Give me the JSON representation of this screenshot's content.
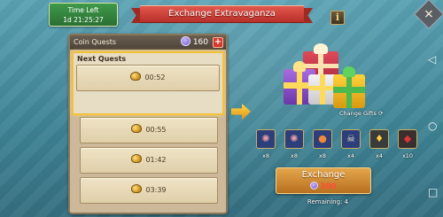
{
  "timer": {
    "label": "Time Left",
    "value": "1d 21:25:27"
  },
  "title": "Exchange Extravaganza",
  "info_icon": "info-icon",
  "panel": {
    "header": "Coin Quests",
    "coins": "160",
    "plus": "+",
    "next_label": "Next Quests",
    "next_quest_time": "00:52",
    "quests": [
      "00:55",
      "01:42",
      "03:39"
    ]
  },
  "change_gifts": "Change Gifts",
  "rewards": [
    {
      "icon": "brain-icon",
      "qty": "x8"
    },
    {
      "icon": "brain-icon",
      "qty": "x8"
    },
    {
      "icon": "orb-icon",
      "qty": "x8"
    },
    {
      "icon": "monster-skull-icon",
      "qty": "x4"
    },
    {
      "icon": "gold-pouch-icon",
      "qty": "x4"
    },
    {
      "icon": "red-gem-icon",
      "qty": "x10"
    }
  ],
  "exchange": {
    "label": "Exchange",
    "cost": "300"
  },
  "remaining": "Remaining: 4",
  "colors": {
    "accent_gold": "#f2c23a",
    "ribbon_red": "#c23a31",
    "timer_green": "#2f7d38"
  }
}
